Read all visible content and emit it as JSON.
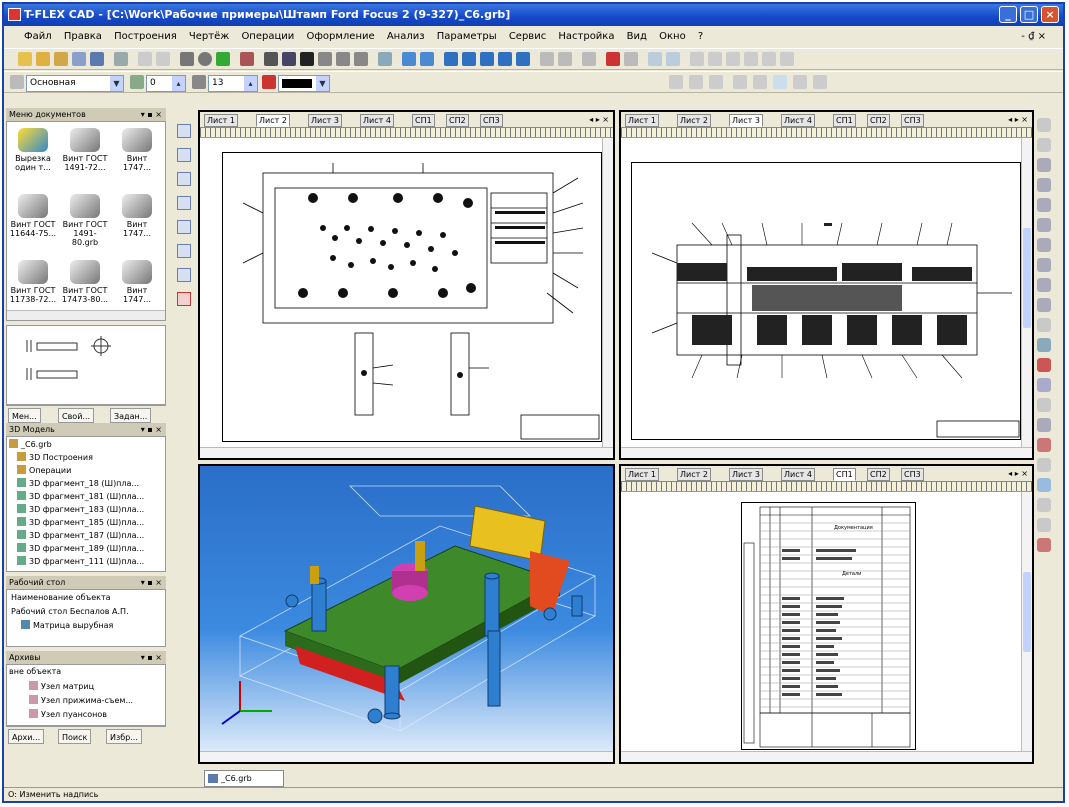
{
  "window": {
    "title": "T-FLEX CAD - [C:\\Work\\Рабочие примеры\\Штамп Ford Focus 2 (9-327)_C6.grb]",
    "minimize": "_",
    "maximize": "□",
    "close": "×"
  },
  "menu": {
    "items": [
      "Файл",
      "Правка",
      "Построения",
      "Чертёж",
      "Операции",
      "Оформление",
      "Анализ",
      "Параметры",
      "Сервис",
      "Настройка",
      "Вид",
      "Окно",
      "?"
    ],
    "mdi_controls": "- ₫ ×"
  },
  "toolbar": {
    "layer_combo": "Основная",
    "level_combo": "0",
    "font_combo": "13"
  },
  "left_dock": {
    "library_header": "Меню документов",
    "library_items": [
      {
        "label": "Вырезка один т..."
      },
      {
        "label": "Винт ГОСТ 1491-72..."
      },
      {
        "label": "Винт 1747..."
      },
      {
        "label": "Винт ГОСТ 11644-75..."
      },
      {
        "label": "Винт ГОСТ 1491-80.grb"
      },
      {
        "label": "Винт 1747..."
      },
      {
        "label": "Винт ГОСТ 11738-72..."
      },
      {
        "label": "Винт ГОСТ 17473-80..."
      },
      {
        "label": "Винт 1747..."
      }
    ],
    "bottom_tabs": [
      "Мен...",
      "Свой...",
      "Задан..."
    ],
    "model_header": "3D Модель",
    "model_tree": [
      "_C6.grb",
      "3D Построения",
      "Операции",
      "3D фрагмент_18 (Ш)пла...",
      "3D фрагмент_181 (Ш)пла...",
      "3D фрагмент_183 (Ш)пла...",
      "3D фрагмент_185 (Ш)пла...",
      "3D фрагмент_187 (Ш)пла...",
      "3D фрагмент_189 (Ш)пла...",
      "3D фрагмент_111 (Ш)пла..."
    ],
    "workplace_header": "Рабочий стол",
    "workplace_items": [
      "Наименование объекта",
      "Рабочий стол  Беспалов А.П.",
      "Матрица вырубная"
    ],
    "admin_header": "Архивы",
    "admin_items": [
      "вне объекта",
      "Узел матриц",
      "Узел прижима-съем...",
      "Узел пуансонов"
    ],
    "admin_tabs": [
      "Архи...",
      "Поиск",
      "Избр..."
    ]
  },
  "views": {
    "top_left_tabs": [
      "Лист 1",
      "Лист 2",
      "Лист 3",
      "Лист 4",
      "СП1",
      "СП2",
      "СП3"
    ],
    "top_left_active": 1,
    "top_right_tabs": [
      "Лист 1",
      "Лист 2",
      "Лист 3",
      "Лист 4",
      "СП1",
      "СП2",
      "СП3"
    ],
    "top_right_active": 2,
    "bottom_right_tabs": [
      "Лист 1",
      "Лист 2",
      "Лист 3",
      "Лист 4",
      "СП1",
      "СП2",
      "СП3"
    ],
    "bottom_right_active": 4,
    "spec_title1": "Документация",
    "spec_title2": "Детали"
  },
  "document_tab": "_C6.grb",
  "status": "О: Изменить надпись",
  "colors": {
    "title_blue": "#1548c8",
    "model_bg_top": "#2a78d8",
    "plate_green": "#3e8a2a",
    "die_red": "#d02020",
    "slide_yellow": "#e8c020",
    "pin_blue": "#2f7fd0",
    "boss_magenta": "#d040b0"
  }
}
